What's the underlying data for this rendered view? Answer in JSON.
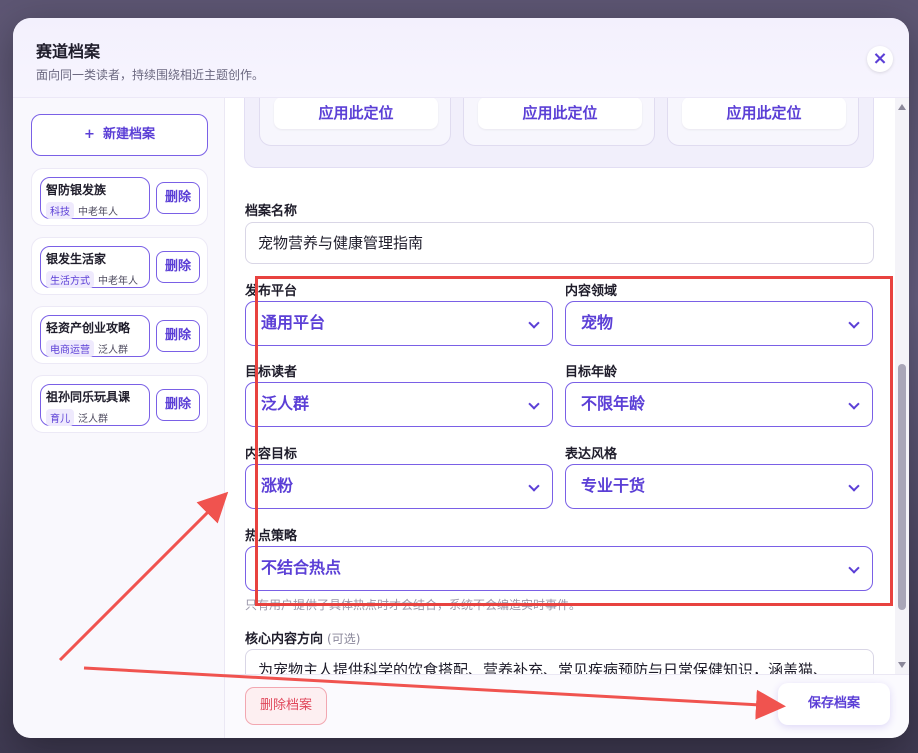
{
  "header": {
    "title": "赛道档案",
    "subtitle": "面向同一类读者，持续围绕相近主题创作。",
    "close_icon": "×"
  },
  "sidebar": {
    "new_button_icon": "+",
    "new_button_label": "新建档案",
    "profiles": [
      {
        "name": "智防银发族",
        "tag": "科技",
        "audience": "中老年人",
        "delete_label": "删除"
      },
      {
        "name": "银发生活家",
        "tag": "生活方式",
        "audience": "中老年人",
        "delete_label": "删除"
      },
      {
        "name": "轻资产创业攻略",
        "tag": "电商运营",
        "audience": "泛人群",
        "delete_label": "删除"
      },
      {
        "name": "祖孙同乐玩具课",
        "tag": "育儿",
        "audience": "泛人群",
        "delete_label": "删除"
      }
    ]
  },
  "presets": {
    "apply_label": "应用此定位"
  },
  "form": {
    "name_label": "档案名称",
    "name_value": "宠物营养与健康管理指南",
    "platform_label": "发布平台",
    "platform_value": "通用平台",
    "domain_label": "内容领域",
    "domain_value": "宠物",
    "audience_label": "目标读者",
    "audience_value": "泛人群",
    "age_label": "目标年龄",
    "age_value": "不限年龄",
    "goal_label": "内容目标",
    "goal_value": "涨粉",
    "style_label": "表达风格",
    "style_value": "专业干货",
    "hotspot_label": "热点策略",
    "hotspot_value": "不结合热点",
    "hint": "只有用户提供了具体热点时才会结合，系统不会编造实时事件。",
    "direction_label": "核心内容方向",
    "direction_optional": "(可选)",
    "direction_value": "为宠物主人提供科学的饮食搭配、营养补充、常见疾病预防与日常保健知识，涵盖猫、"
  },
  "footer": {
    "delete_label": "删除档案",
    "save_label": "保存档案"
  },
  "colors": {
    "accent": "#5b3fd6",
    "annotation_red": "#e8423f"
  }
}
